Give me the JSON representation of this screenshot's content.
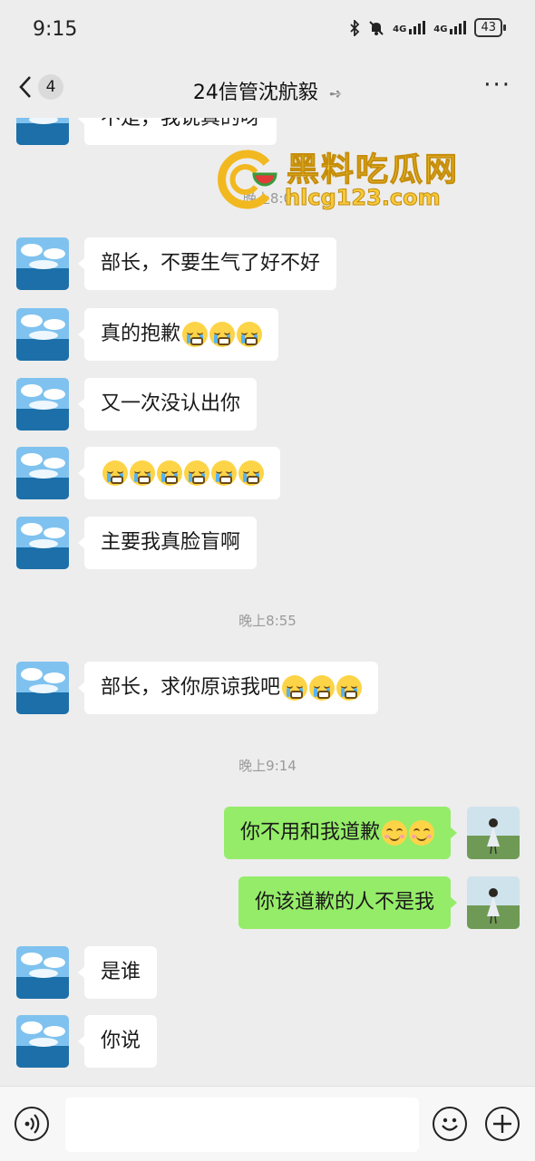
{
  "status_bar": {
    "time": "9:15",
    "network1": "4G",
    "network2": "4G",
    "battery": "43"
  },
  "nav": {
    "back_count": "4",
    "title": "24信管沈航毅"
  },
  "watermark": {
    "line1": "黑料吃瓜网",
    "line2": "hlcg123.com"
  },
  "messages": [
    {
      "text": "不是，我说真的呀"
    },
    {
      "time": "晚上8:0"
    },
    {
      "text": "部长，不要生气了好不好"
    },
    {
      "text": "真的抱歉",
      "emoji": [
        "cry-laugh",
        "cry-laugh",
        "cry-laugh"
      ]
    },
    {
      "text": "又一次没认出你"
    },
    {
      "text": "",
      "emoji": [
        "cry-laugh",
        "cry-laugh",
        "cry-laugh",
        "cry-laugh",
        "cry-laugh",
        "cry-laugh"
      ]
    },
    {
      "text": "主要我真脸盲啊"
    },
    {
      "time": "晚上8:55"
    },
    {
      "text": "部长，求你原谅我吧",
      "emoji": [
        "cry-laugh",
        "cry-laugh",
        "cry-laugh"
      ]
    },
    {
      "time": "晚上9:14"
    },
    {
      "text": "你不用和我道歉",
      "emoji": [
        "smile",
        "smile"
      ]
    },
    {
      "text": "你该道歉的人不是我"
    },
    {
      "text": "是谁"
    },
    {
      "text": "你说"
    }
  ],
  "colors": {
    "background": "#ededed",
    "incoming_bubble": "#ffffff",
    "outgoing_bubble": "#95ec69"
  }
}
